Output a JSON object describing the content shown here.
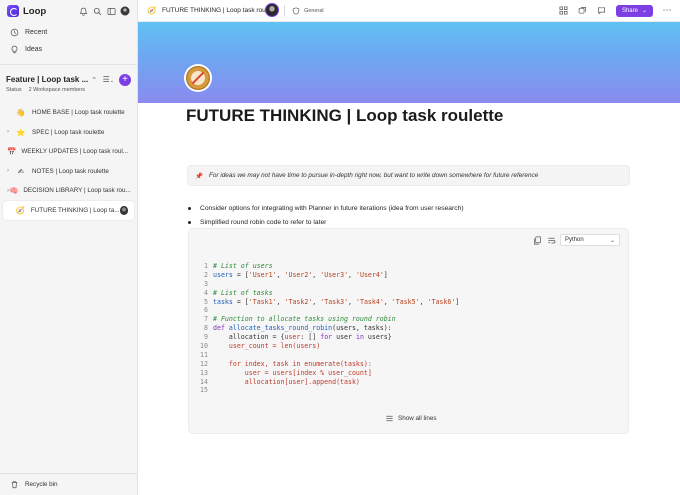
{
  "app": {
    "name": "Loop"
  },
  "sidebar": {
    "nav": [
      {
        "label": "Recent",
        "icon": "clock-icon"
      },
      {
        "label": "Ideas",
        "icon": "lightbulb-icon"
      }
    ],
    "workspace": {
      "title": "Feature | Loop task ...",
      "status": "Status",
      "members": "2 Workspace members"
    },
    "pages": [
      {
        "label": "HOME BASE | Loop task roulette",
        "emoji": "👋",
        "expandable": false
      },
      {
        "label": "SPEC | Loop task roulette",
        "emoji": "⭐",
        "expandable": true
      },
      {
        "label": "WEEKLY UPDATES | Loop task roul...",
        "emoji": "📅",
        "expandable": false
      },
      {
        "label": "NOTES | Loop task roulette",
        "emoji": "✍",
        "expandable": true
      },
      {
        "label": "DECISION LIBRARY | Loop task rou...",
        "emoji": "🧠",
        "expandable": true
      },
      {
        "label": "FUTURE THINKING | Loop ta...",
        "emoji": "🧭",
        "expandable": false,
        "active": true
      }
    ],
    "recycle_bin": "Recycle bin"
  },
  "topbar": {
    "page_title": "FUTURE THINKING | Loop task roulette",
    "sensitivity": "General",
    "share_label": "Share"
  },
  "page": {
    "title": "FUTURE THINKING | Loop task roulette",
    "callout": "For ideas we may not have time to pursue in-depth right now, but want to write down somewhere for future reference",
    "bullets": [
      "Consider options for integrating with Planner in future iterations (idea from user research)",
      "Simplified round robin code to refer to later"
    ],
    "code": {
      "language": "Python",
      "show_all_label": "Show all lines",
      "lines": [
        "1",
        "2",
        "3",
        "4",
        "5",
        "6",
        "7",
        "8",
        "9",
        "10",
        "11",
        "12",
        "13",
        "14",
        "15"
      ]
    }
  },
  "colors": {
    "accent": "#7b3fe4",
    "banner_top": "#5fc1f3",
    "banner_bottom": "#8a8bee"
  }
}
